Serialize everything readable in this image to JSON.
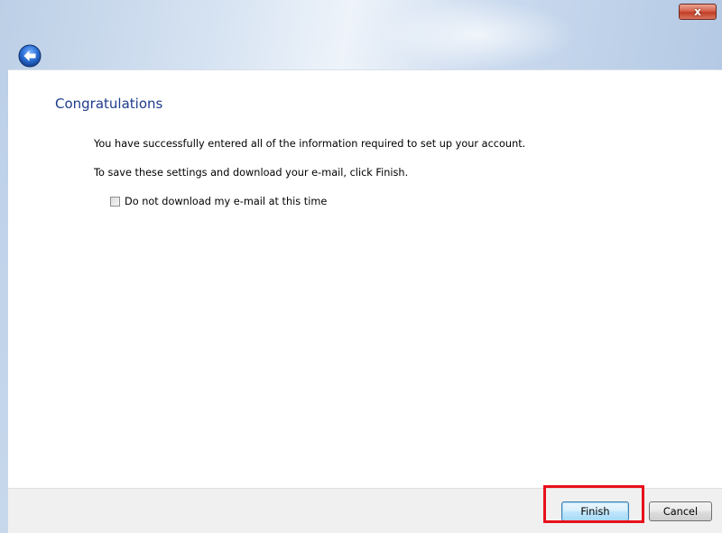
{
  "window": {
    "close_label": "x"
  },
  "header": {
    "back_icon": "back-arrow-icon"
  },
  "main": {
    "title": "Congratulations",
    "message_1": "You have successfully entered all of the information required to set up your account.",
    "message_2": "To save these settings and download your e-mail, click Finish.",
    "checkbox": {
      "label": "Do not download my e-mail at this time",
      "checked": false
    }
  },
  "footer": {
    "finish_label": "Finish",
    "cancel_label": "Cancel"
  },
  "colors": {
    "heading": "#1e3c8c",
    "highlight": "#e8101a",
    "back_button": "#2b6fd6"
  }
}
